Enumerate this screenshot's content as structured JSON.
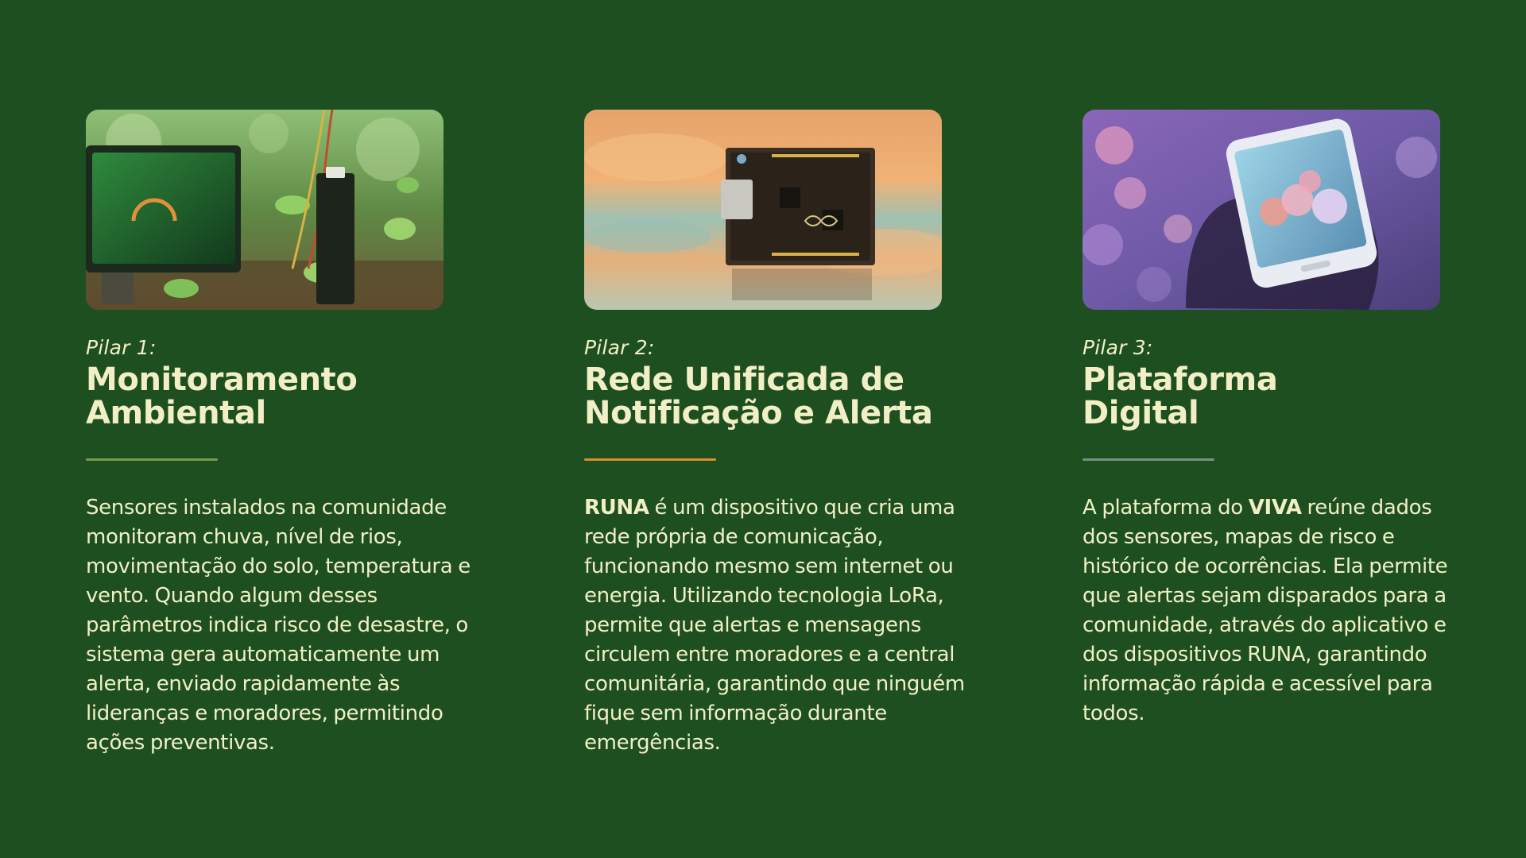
{
  "pillars": [
    {
      "kicker": "Pilar 1:",
      "title": "Monitoramento\nAmbiental",
      "rule_color": "#7a9b4e",
      "image_icon": "soil-sensor-photo",
      "body": "Sensores instalados na comunidade monitoram chuva, nível de rios, movimentação do solo, temperatura e vento. Quando algum desses parâmetros indica risco de desastre, o sistema gera automaticamente um alerta, enviado rapidamente às lideranças e moradores, permitindo ações preventivas."
    },
    {
      "kicker": "Pilar 2:",
      "title": "Rede Unificada de\nNotificação e Alerta",
      "rule_color": "#d9902d",
      "image_icon": "arduino-board-photo",
      "body_strong": "RUNA",
      "body": " é um dispositivo que cria uma rede própria de comunicação, funcionando mesmo sem internet ou energia. Utilizando tecnologia LoRa, permite que alertas e mensagens circulem entre moradores e a central comunitária, garantindo que ninguém fique sem informação durante emergências."
    },
    {
      "kicker": "Pilar 3:",
      "title": "Plataforma\nDigital",
      "rule_color": "#7c8f86",
      "image_icon": "smartphone-photo",
      "body_lead": "A plataforma do ",
      "body_strong": "VIVA",
      "body": " reúne dados dos sensores, mapas de risco e histórico de ocorrências. Ela permite que alertas sejam disparados para a comunidade, através do aplicativo e dos dispositivos RUNA, garantindo informação rápida e acessível para todos."
    }
  ],
  "colors": {
    "background": "#1d4f21",
    "text": "#f2efc6"
  }
}
